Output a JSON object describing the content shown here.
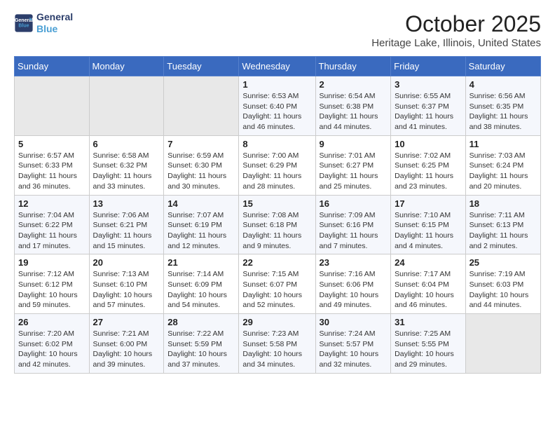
{
  "header": {
    "logo_line1": "General",
    "logo_line2": "Blue",
    "month": "October 2025",
    "location": "Heritage Lake, Illinois, United States"
  },
  "weekdays": [
    "Sunday",
    "Monday",
    "Tuesday",
    "Wednesday",
    "Thursday",
    "Friday",
    "Saturday"
  ],
  "weeks": [
    [
      {
        "day": "",
        "info": ""
      },
      {
        "day": "",
        "info": ""
      },
      {
        "day": "",
        "info": ""
      },
      {
        "day": "1",
        "info": "Sunrise: 6:53 AM\nSunset: 6:40 PM\nDaylight: 11 hours and 46 minutes."
      },
      {
        "day": "2",
        "info": "Sunrise: 6:54 AM\nSunset: 6:38 PM\nDaylight: 11 hours and 44 minutes."
      },
      {
        "day": "3",
        "info": "Sunrise: 6:55 AM\nSunset: 6:37 PM\nDaylight: 11 hours and 41 minutes."
      },
      {
        "day": "4",
        "info": "Sunrise: 6:56 AM\nSunset: 6:35 PM\nDaylight: 11 hours and 38 minutes."
      }
    ],
    [
      {
        "day": "5",
        "info": "Sunrise: 6:57 AM\nSunset: 6:33 PM\nDaylight: 11 hours and 36 minutes."
      },
      {
        "day": "6",
        "info": "Sunrise: 6:58 AM\nSunset: 6:32 PM\nDaylight: 11 hours and 33 minutes."
      },
      {
        "day": "7",
        "info": "Sunrise: 6:59 AM\nSunset: 6:30 PM\nDaylight: 11 hours and 30 minutes."
      },
      {
        "day": "8",
        "info": "Sunrise: 7:00 AM\nSunset: 6:29 PM\nDaylight: 11 hours and 28 minutes."
      },
      {
        "day": "9",
        "info": "Sunrise: 7:01 AM\nSunset: 6:27 PM\nDaylight: 11 hours and 25 minutes."
      },
      {
        "day": "10",
        "info": "Sunrise: 7:02 AM\nSunset: 6:25 PM\nDaylight: 11 hours and 23 minutes."
      },
      {
        "day": "11",
        "info": "Sunrise: 7:03 AM\nSunset: 6:24 PM\nDaylight: 11 hours and 20 minutes."
      }
    ],
    [
      {
        "day": "12",
        "info": "Sunrise: 7:04 AM\nSunset: 6:22 PM\nDaylight: 11 hours and 17 minutes."
      },
      {
        "day": "13",
        "info": "Sunrise: 7:06 AM\nSunset: 6:21 PM\nDaylight: 11 hours and 15 minutes."
      },
      {
        "day": "14",
        "info": "Sunrise: 7:07 AM\nSunset: 6:19 PM\nDaylight: 11 hours and 12 minutes."
      },
      {
        "day": "15",
        "info": "Sunrise: 7:08 AM\nSunset: 6:18 PM\nDaylight: 11 hours and 9 minutes."
      },
      {
        "day": "16",
        "info": "Sunrise: 7:09 AM\nSunset: 6:16 PM\nDaylight: 11 hours and 7 minutes."
      },
      {
        "day": "17",
        "info": "Sunrise: 7:10 AM\nSunset: 6:15 PM\nDaylight: 11 hours and 4 minutes."
      },
      {
        "day": "18",
        "info": "Sunrise: 7:11 AM\nSunset: 6:13 PM\nDaylight: 11 hours and 2 minutes."
      }
    ],
    [
      {
        "day": "19",
        "info": "Sunrise: 7:12 AM\nSunset: 6:12 PM\nDaylight: 10 hours and 59 minutes."
      },
      {
        "day": "20",
        "info": "Sunrise: 7:13 AM\nSunset: 6:10 PM\nDaylight: 10 hours and 57 minutes."
      },
      {
        "day": "21",
        "info": "Sunrise: 7:14 AM\nSunset: 6:09 PM\nDaylight: 10 hours and 54 minutes."
      },
      {
        "day": "22",
        "info": "Sunrise: 7:15 AM\nSunset: 6:07 PM\nDaylight: 10 hours and 52 minutes."
      },
      {
        "day": "23",
        "info": "Sunrise: 7:16 AM\nSunset: 6:06 PM\nDaylight: 10 hours and 49 minutes."
      },
      {
        "day": "24",
        "info": "Sunrise: 7:17 AM\nSunset: 6:04 PM\nDaylight: 10 hours and 46 minutes."
      },
      {
        "day": "25",
        "info": "Sunrise: 7:19 AM\nSunset: 6:03 PM\nDaylight: 10 hours and 44 minutes."
      }
    ],
    [
      {
        "day": "26",
        "info": "Sunrise: 7:20 AM\nSunset: 6:02 PM\nDaylight: 10 hours and 42 minutes."
      },
      {
        "day": "27",
        "info": "Sunrise: 7:21 AM\nSunset: 6:00 PM\nDaylight: 10 hours and 39 minutes."
      },
      {
        "day": "28",
        "info": "Sunrise: 7:22 AM\nSunset: 5:59 PM\nDaylight: 10 hours and 37 minutes."
      },
      {
        "day": "29",
        "info": "Sunrise: 7:23 AM\nSunset: 5:58 PM\nDaylight: 10 hours and 34 minutes."
      },
      {
        "day": "30",
        "info": "Sunrise: 7:24 AM\nSunset: 5:57 PM\nDaylight: 10 hours and 32 minutes."
      },
      {
        "day": "31",
        "info": "Sunrise: 7:25 AM\nSunset: 5:55 PM\nDaylight: 10 hours and 29 minutes."
      },
      {
        "day": "",
        "info": ""
      }
    ]
  ]
}
